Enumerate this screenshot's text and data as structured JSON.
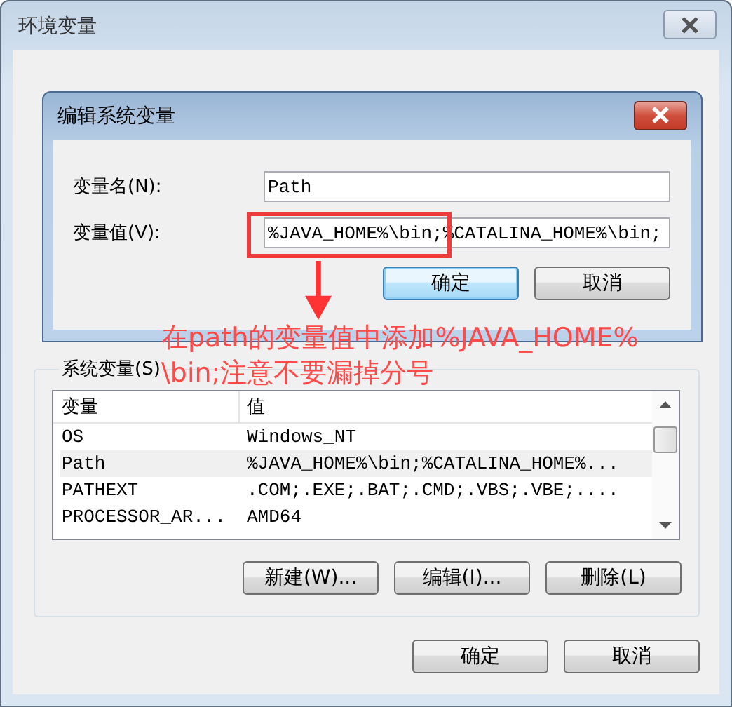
{
  "window": {
    "title": "环境变量"
  },
  "edit_dialog": {
    "title": "编辑系统变量",
    "fields": [
      {
        "label": "变量名(N):",
        "value": "Path"
      },
      {
        "label": "变量值(V):",
        "value": "%JAVA_HOME%\\bin;%CATALINA_HOME%\\bin;"
      }
    ],
    "buttons": [
      {
        "label": "确定",
        "default": true
      },
      {
        "label": "取消",
        "default": false
      }
    ]
  },
  "annotation": {
    "text": "在path的变量值中添加%JAVA_HOME%\\bin;注意不要漏掉分号"
  },
  "system_variables": {
    "label": "系统变量(S)",
    "columns": [
      "变量",
      "值"
    ],
    "rows": [
      {
        "name": "OS",
        "value": "Windows_NT",
        "selected": false
      },
      {
        "name": "Path",
        "value": "%JAVA_HOME%\\bin;%CATALINA_HOME%...",
        "selected": true
      },
      {
        "name": "PATHEXT",
        "value": ".COM;.EXE;.BAT;.CMD;.VBS;.VBE;....",
        "selected": false
      },
      {
        "name": "PROCESSOR_AR...",
        "value": "AMD64",
        "selected": false
      }
    ],
    "buttons": [
      "新建(W)...",
      "编辑(I)...",
      "删除(L)"
    ]
  },
  "buttons": [
    "确定",
    "取消"
  ]
}
